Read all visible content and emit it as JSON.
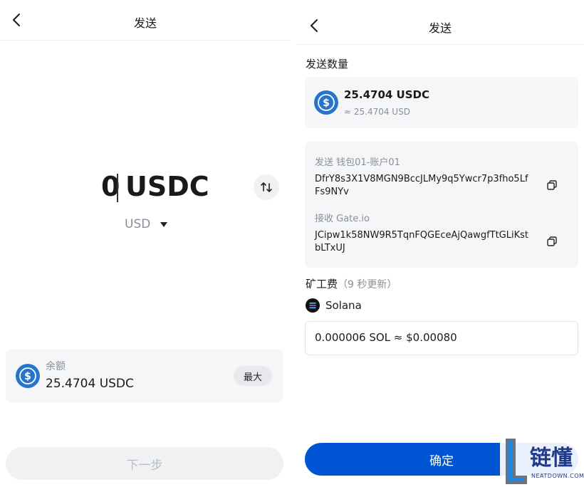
{
  "left": {
    "header": {
      "title": "发送"
    },
    "amount": {
      "value": "0",
      "unit": "USDC"
    },
    "currency": {
      "selected": "USD"
    },
    "balance": {
      "label": "余额",
      "value": "25.4704 USDC",
      "max_label": "最大"
    },
    "next_label": "下一步"
  },
  "right": {
    "header": {
      "title": "发送"
    },
    "send_amount_label": "发送数量",
    "amount": {
      "main": "25.4704 USDC",
      "sub": "≈ 25.4704 USD"
    },
    "from": {
      "label": "发送 钱包01-账户01",
      "address": "DfrY8s3X1V8MGN9BccJLMy9q5Ywcr7p3fho5LfFs9NYv"
    },
    "to": {
      "label": "接收 Gate.io",
      "address": "JCipw1k58NW9R5TqnFQGEceAjQawgfTtGLiKstbLTxUJ"
    },
    "fee": {
      "label": "矿工费",
      "hint": "（9 秒更新）",
      "network": "Solana",
      "value": "0.000006 SOL ≈ $0.00080"
    },
    "confirm_label": "确定"
  },
  "watermark": {
    "text": "链懂",
    "sub": "NEATDOWN.COM"
  },
  "colors": {
    "accent": "#0055d4",
    "usdc": "#2775ca",
    "card": "#f5f6f8"
  },
  "icons": {
    "back": "chevron-left-icon",
    "swap": "swap-vertical-icon",
    "coin": "usdc-icon",
    "copy": "copy-icon",
    "network": "solana-icon"
  }
}
